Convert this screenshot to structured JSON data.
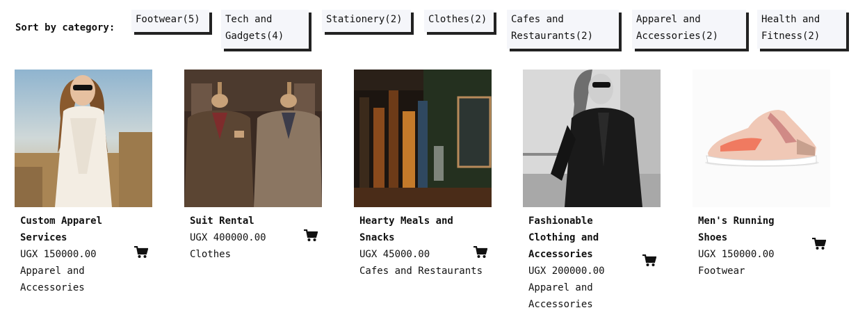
{
  "filter": {
    "sort_label": "Sort by category:",
    "categories": [
      {
        "label": "Footwear(5)"
      },
      {
        "label": "Tech and Gadgets(4)"
      },
      {
        "label": "Stationery(2)"
      },
      {
        "label": "Clothes(2)"
      },
      {
        "label": "Cafes and Restaurants(2)"
      },
      {
        "label": "Apparel and Accessories(2)"
      },
      {
        "label": "Health and Fitness(2)"
      }
    ]
  },
  "products": [
    {
      "title": "Custom Apparel Services",
      "price": "UGX 150000.00",
      "category": "Apparel and Accessories",
      "image": "woman-in-white-dress-photo"
    },
    {
      "title": "Suit Rental",
      "price": "UGX 400000.00",
      "category": "Clothes",
      "image": "suits-on-mannequins-photo"
    },
    {
      "title": "Hearty Meals and Snacks",
      "price": "UGX 45000.00",
      "category": "Cafes and Restaurants",
      "image": "bar-bottles-glasses-photo"
    },
    {
      "title": "Fashionable Clothing and Accessories",
      "price": "UGX 200000.00",
      "category": "Apparel and Accessories",
      "image": "woman-leather-jacket-photo"
    },
    {
      "title": "Men's Running Shoes",
      "price": "UGX 150000.00",
      "category": "Footwear",
      "image": "running-shoe-photo"
    }
  ],
  "icons": {
    "cart": "shopping-cart-icon"
  },
  "colors": {
    "button_bg": "#f5f6fa",
    "button_shadow": "#222222",
    "text": "#111111"
  }
}
